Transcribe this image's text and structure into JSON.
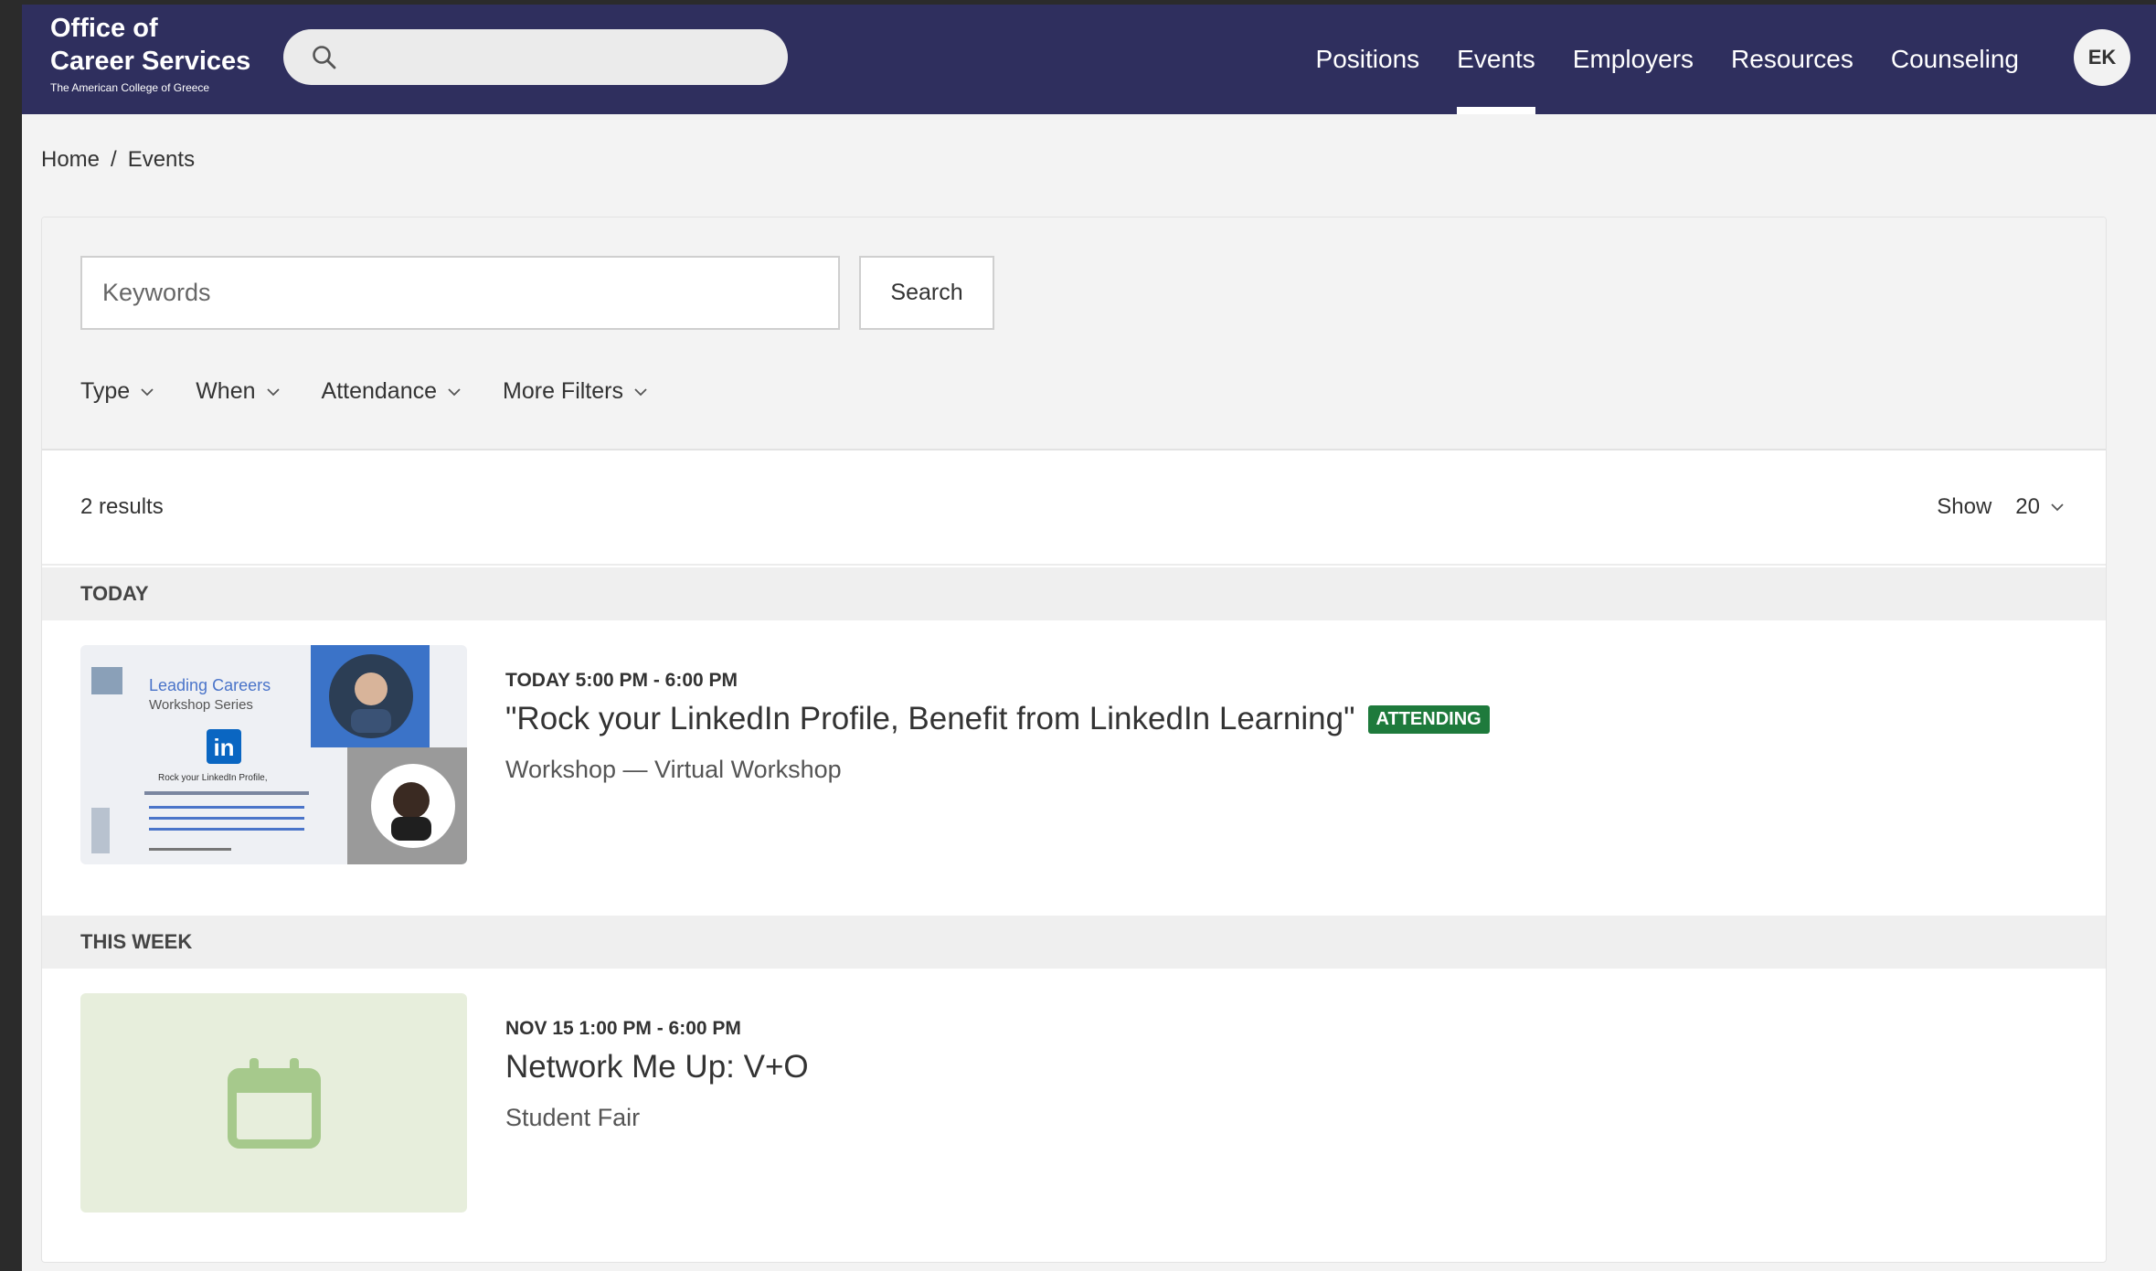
{
  "header": {
    "logo_line1": "Office of",
    "logo_line2": "Career Services",
    "logo_line3": "The American College of Greece",
    "nav": [
      {
        "label": "Positions",
        "active": false
      },
      {
        "label": "Events",
        "active": true
      },
      {
        "label": "Employers",
        "active": false
      },
      {
        "label": "Resources",
        "active": false
      },
      {
        "label": "Counseling",
        "active": false
      }
    ],
    "avatar_initials": "EK"
  },
  "breadcrumb": {
    "home": "Home",
    "sep": "/",
    "current": "Events"
  },
  "filters": {
    "keywords_placeholder": "Keywords",
    "search_label": "Search",
    "type": "Type",
    "when": "When",
    "attendance": "Attendance",
    "more": "More Filters"
  },
  "results": {
    "count": "2 results",
    "show_label": "Show",
    "show_value": "20"
  },
  "groups": [
    {
      "label": "TODAY",
      "event": {
        "time": "TODAY 5:00 PM - 6:00 PM",
        "title": "\"Rock your LinkedIn Profile, Benefit from LinkedIn Learning\"",
        "badge": "ATTENDING",
        "subtitle": "Workshop — Virtual Workshop",
        "thumb_title": "Leading Careers",
        "thumb_subtitle": "Workshop Series",
        "thumb_caption": "Rock your LinkedIn Profile,"
      }
    },
    {
      "label": "THIS WEEK",
      "event": {
        "time": "NOV 15 1:00 PM - 6:00 PM",
        "title": "Network Me Up: V+O",
        "subtitle": "Student Fair"
      }
    }
  ],
  "colors": {
    "header_bg": "#2f2f5e",
    "badge_bg": "#1e7a3c",
    "placeholder_bg": "#e7eedc",
    "calendar_icon": "#a6c98c"
  }
}
